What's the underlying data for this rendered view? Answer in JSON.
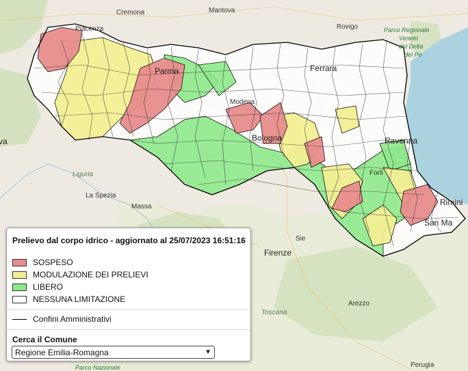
{
  "legend": {
    "title": "Prelievo dal corpo idrico - aggiornato al 25/07/2023 16:51:16",
    "items": [
      {
        "label": "SOSPESO",
        "color": "#e88c8c"
      },
      {
        "label": "MODULAZIONE DEI PRELIEVI",
        "color": "#f2ef93"
      },
      {
        "label": "LIBERO",
        "color": "#8ee88a"
      },
      {
        "label": "NESSUNA LIMITAZIONE",
        "color": "#ffffff"
      }
    ],
    "boundary_label": "Confini Amministrativi",
    "search_label": "Cerca il Comune",
    "select_value": "Regione Emilia-Romagna",
    "select_icon": "chevron-down-icon"
  },
  "map": {
    "labels": {
      "cremona": "Cremona",
      "mantova": "Mantova",
      "rovigo": "Rovigo",
      "park": "Parco Regionale",
      "park2": "Veneto",
      "park3": "del Delta",
      "park4": "del Po",
      "piacenza": "Piacenza",
      "parma": "Parma",
      "modena": "Modena",
      "ferrara": "Ferrara",
      "bologna": "Bologna",
      "ravenna": "Ravenna",
      "forli": "Forlì",
      "rimini": "Rimini",
      "sanmarino": "San Ma",
      "liguria": "Liguria",
      "laspezia": "La Spezia",
      "massa": "Massa",
      "firenze": "Firenze",
      "arezzo": "Arezzo",
      "toscana": "Toscana",
      "perugia": "Perugia",
      "parconaz": "Parco Nazionale",
      "edge": "va",
      "sieci": "Sie"
    }
  }
}
